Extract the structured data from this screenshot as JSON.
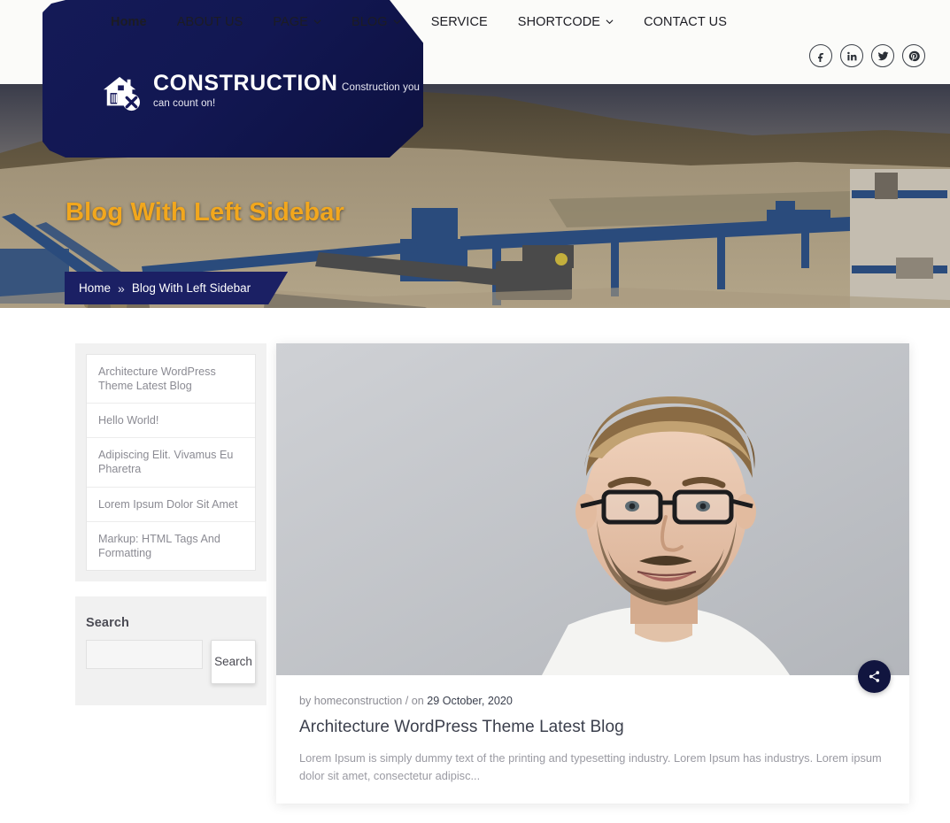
{
  "site": {
    "brand": "CONSTRUCTION",
    "tagline": "Construction you can count on!",
    "logo_icon": "house-tools-icon"
  },
  "nav": {
    "items": [
      {
        "label": "Home",
        "has_caret": false
      },
      {
        "label": "ABOUT US",
        "has_caret": false
      },
      {
        "label": "PAGE",
        "has_caret": true
      },
      {
        "label": "BLOG",
        "has_caret": true
      },
      {
        "label": "SERVICE",
        "has_caret": false
      },
      {
        "label": "SHORTCODE",
        "has_caret": true
      },
      {
        "label": "CONTACT US",
        "has_caret": false
      }
    ]
  },
  "socials": [
    {
      "name": "facebook-icon",
      "glyph": "f"
    },
    {
      "name": "linkedin-icon",
      "glyph": "in"
    },
    {
      "name": "twitter-icon",
      "glyph": "t"
    },
    {
      "name": "pinterest-icon",
      "glyph": "p"
    }
  ],
  "hero": {
    "title": "Blog With Left Sidebar",
    "breadcrumb_home": "Home",
    "breadcrumb_separator": "»",
    "breadcrumb_current": "Blog With Left Sidebar"
  },
  "sidebar": {
    "recent_posts": [
      "Architecture WordPress Theme Latest Blog",
      "Hello World!",
      "Adipiscing Elit. Vivamus Eu Pharetra",
      "Lorem Ipsum Dolor Sit Amet",
      "Markup: HTML Tags And Formatting"
    ],
    "search": {
      "title": "Search",
      "value": "",
      "placeholder": "",
      "button_label": "Search"
    }
  },
  "post": {
    "image_alt": "man-with-glasses-portrait",
    "meta_prefix": "by homeconstruction / on ",
    "author": "homeconstruction",
    "date": "29 October, 2020",
    "title": "Architecture WordPress Theme Latest Blog",
    "excerpt": "Lorem Ipsum is simply dummy text of the printing and typesetting industry. Lorem Ipsum has industrys. Lorem ipsum dolor sit amet, consectetur adipisc...",
    "share_icon": "share-icon"
  },
  "colors": {
    "navy": "#141a57",
    "navy_dark": "#0d1140",
    "accent_gold": "#f2a71d",
    "header_bg": "#fbfbf9",
    "widget_bg": "#f1f1f1",
    "muted_text": "#8b8b93"
  }
}
